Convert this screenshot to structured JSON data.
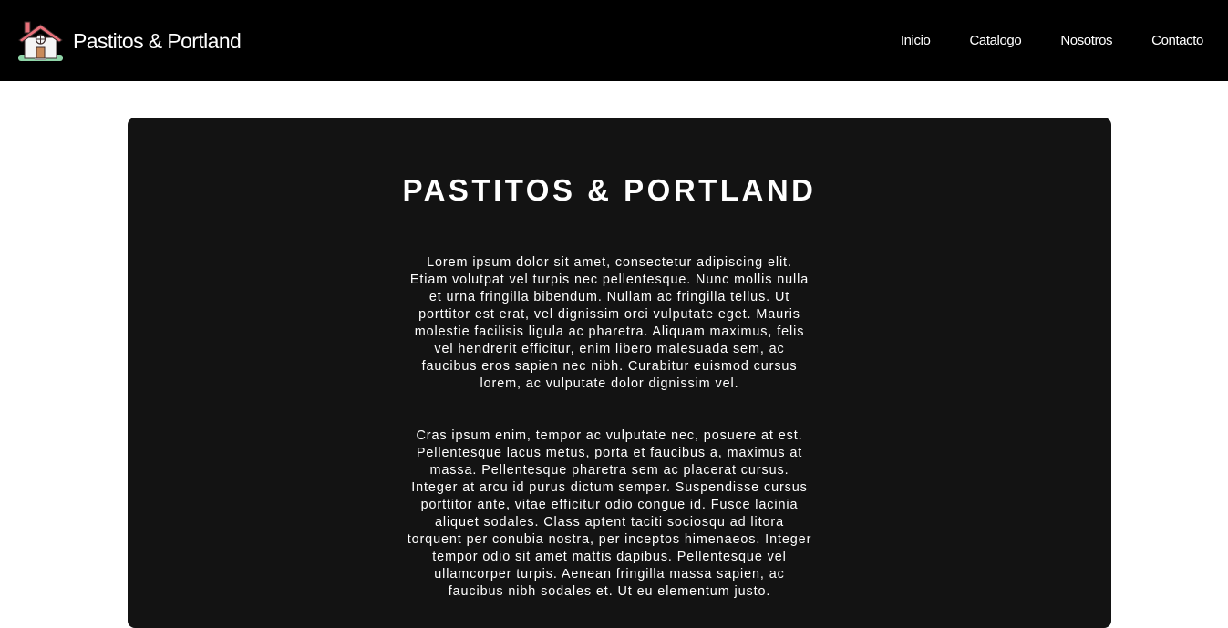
{
  "brand": {
    "name": "Pastitos & Portland"
  },
  "nav": {
    "items": [
      "Inicio",
      "Catalogo",
      "Nosotros",
      "Contacto"
    ]
  },
  "main": {
    "title": "PASTITOS & PORTLAND",
    "paragraphs": [
      [
        "Lorem ipsum dolor sit amet, consectetur adipiscing elit.",
        "Etiam volutpat vel turpis nec pellentesque. Nunc mollis nulla",
        "et urna fringilla bibendum. Nullam ac fringilla tellus. Ut",
        "porttitor est erat, vel dignissim orci vulputate eget. Mauris",
        "molestie facilisis ligula ac pharetra. Aliquam maximus, felis",
        "vel hendrerit efficitur, enim libero malesuada sem, ac",
        "faucibus eros sapien nec nibh. Curabitur euismod cursus",
        "lorem, ac vulputate dolor dignissim vel."
      ],
      [
        "Cras ipsum enim, tempor ac vulputate nec, posuere at est.",
        "Pellentesque lacus metus, porta et faucibus a, maximus at",
        "massa. Pellentesque pharetra sem ac placerat cursus.",
        "Integer at arcu id purus dictum semper. Suspendisse cursus",
        "porttitor ante, vitae efficitur odio congue id. Fusce lacinia",
        "aliquet sodales. Class aptent taciti sociosqu ad litora",
        "torquent per conubia nostra, per inceptos himenaeos. Integer",
        "tempor odio sit amet mattis dapibus. Pellentesque vel",
        "ullamcorper turpis. Aenean fringilla massa sapien, ac",
        "faucibus nibh sodales et. Ut eu elementum justo."
      ]
    ]
  },
  "colors": {
    "navbar_bg": "#000000",
    "card_bg": "#131313",
    "text": "#ffffff",
    "logo_roof": "#e8707a",
    "logo_ground": "#8fd4a8"
  },
  "icons": {
    "logo": "house-icon"
  }
}
